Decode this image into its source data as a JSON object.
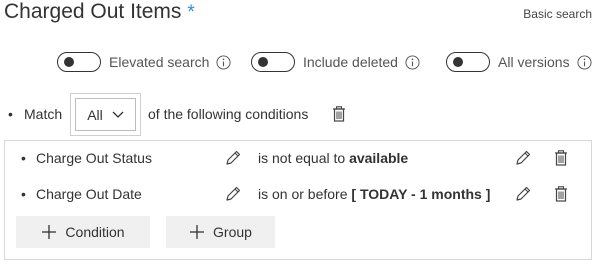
{
  "header": {
    "title": "Charged Out Items",
    "required_marker": "*",
    "basic_search_label": "Basic search"
  },
  "toggles": [
    {
      "label": "Elevated search",
      "on": false
    },
    {
      "label": "Include deleted",
      "on": false
    },
    {
      "label": "All versions",
      "on": false
    }
  ],
  "match": {
    "bullet": "•",
    "prefix": "Match",
    "selected": "All",
    "suffix": "of the following conditions"
  },
  "conditions": [
    {
      "bullet": "•",
      "field": "Charge Out Status",
      "operator": "is not equal to",
      "value": "available"
    },
    {
      "bullet": "•",
      "field": "Charge Out Date",
      "operator": "is on or before",
      "value": "[ TODAY - 1 months ]"
    }
  ],
  "buttons": {
    "add_condition": "Condition",
    "add_group": "Group"
  },
  "colors": {
    "required_marker": "#2d8dd6",
    "button_bg": "#f0f0f0",
    "panel_border": "#d8d8d8"
  },
  "icons": [
    "info-icon",
    "chevron-down-icon",
    "trash-icon",
    "pencil-icon",
    "plus-icon"
  ]
}
